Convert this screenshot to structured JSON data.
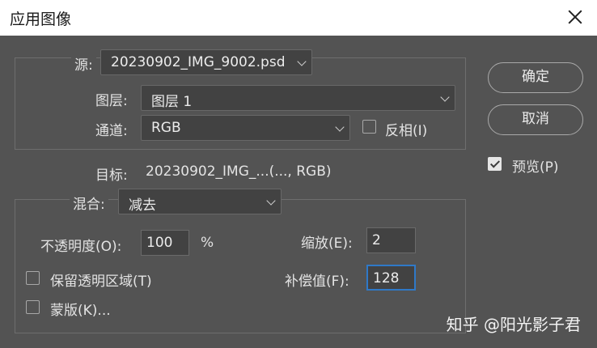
{
  "window": {
    "title": "应用图像"
  },
  "source": {
    "label": "源:",
    "file": "20230902_IMG_9002.psd",
    "layer_label": "图层:",
    "layer": "图层 1",
    "channel_label": "通道:",
    "channel": "RGB",
    "invert_label": "反相(I)"
  },
  "target": {
    "label": "目标:",
    "value": "20230902_IMG_...(..., RGB)"
  },
  "blending": {
    "label": "混合:",
    "mode": "减去",
    "opacity_label": "不透明度(O):",
    "opacity": "100",
    "opacity_unit": "%",
    "scale_label": "缩放(E):",
    "scale": "2",
    "offset_label": "补偿值(F):",
    "offset": "128",
    "preserve_label": "保留透明区域(T)",
    "mask_label": "蒙版(K)..."
  },
  "buttons": {
    "ok": "确定",
    "cancel": "取消"
  },
  "preview": {
    "label": "预览(P)",
    "checked": true
  },
  "watermark": "知乎 @阳光影子君"
}
